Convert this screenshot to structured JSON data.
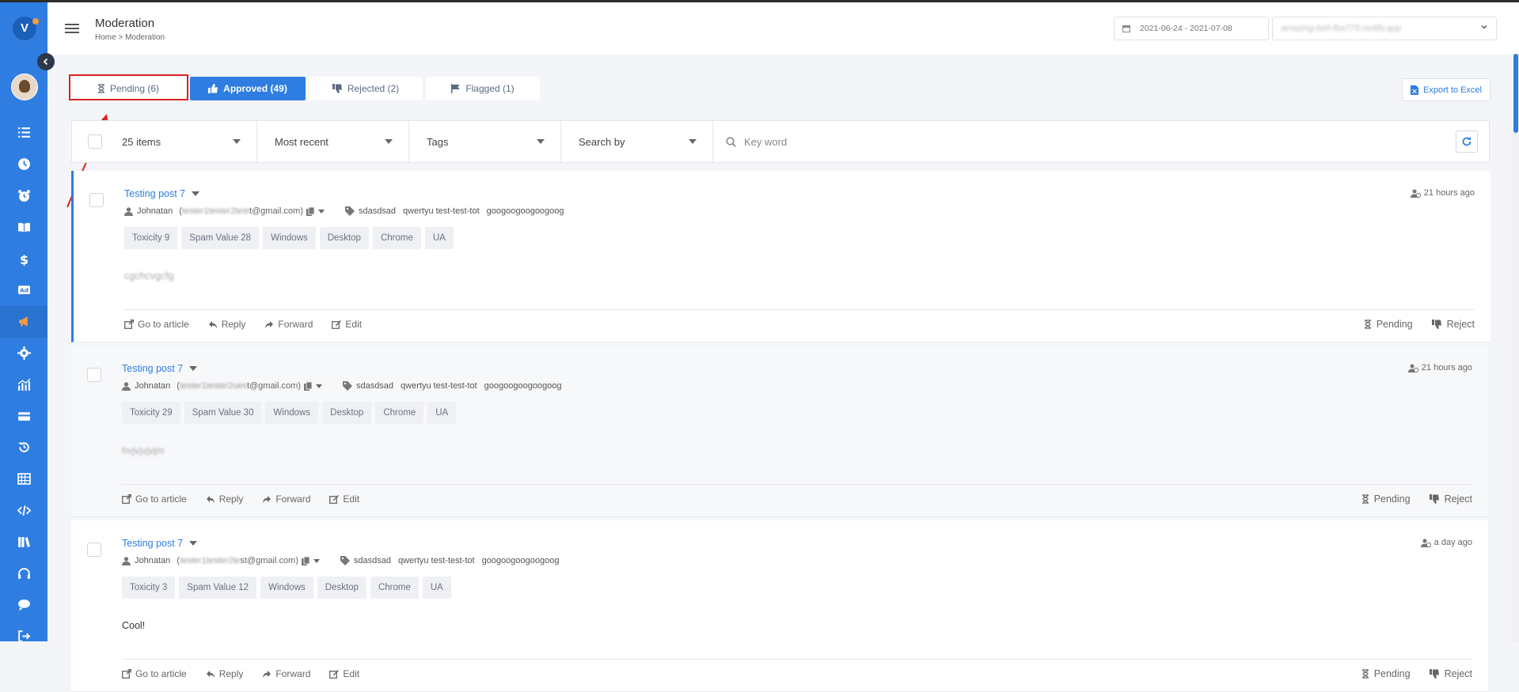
{
  "app": {
    "logo_letter": "V"
  },
  "header": {
    "title": "Moderation",
    "breadcrumb": "Home  > Moderation",
    "date_range": "2021-06-24 - 2021-07-08",
    "site": "amazing-bell-fba775.netlify.app"
  },
  "tabs": {
    "pending": "Pending (6)",
    "approved": "Approved (49)",
    "rejected": "Rejected (2)",
    "flagged": "Flagged (1)"
  },
  "export_label": "Export to Excel",
  "filters": {
    "items": "25 items",
    "sort": "Most recent",
    "tags": "Tags",
    "search_by": "Search by",
    "keyword_placeholder": "Key word"
  },
  "posts": [
    {
      "title": "Testing post 7",
      "time": "21 hours ago",
      "author": "Johnatan",
      "email_prefix": "(",
      "email_blur": "tester1tester2test",
      "email_suffix": "t@gmail.com)",
      "tags": [
        "sdasdsad",
        "qwertyu test-test-tot",
        "googoogoogoogoog"
      ],
      "chips": [
        "Toxicity 9",
        "Spam Value 28",
        "Windows",
        "Desktop",
        "Chrome",
        "UA"
      ],
      "content": "cgchcvgcfg"
    },
    {
      "title": "Testing post 7",
      "time": "21 hours ago",
      "author": "Johnatan",
      "email_prefix": "(",
      "email_blur": "tester1tester2ues",
      "email_suffix": "t@gmail.com)",
      "tags": [
        "sdasdsad",
        "qwertyu test-test-tot",
        "googoogoogoogoog"
      ],
      "chips": [
        "Toxicity 29",
        "Spam Value 30",
        "Windows",
        "Desktop",
        "Chrome",
        "UA"
      ],
      "content": "hvjvjvjvjm"
    },
    {
      "title": "Testing post 7",
      "time": "a day ago",
      "author": "Johnatan",
      "email_prefix": "(",
      "email_blur": "tester1tester2te",
      "email_suffix": "st@gmail.com)",
      "tags": [
        "sdasdsad",
        "qwertyu test-test-tot",
        "googoogoogoogoog"
      ],
      "chips": [
        "Toxicity 3",
        "Spam Value 12",
        "Windows",
        "Desktop",
        "Chrome",
        "UA"
      ],
      "content": "Cool!"
    }
  ],
  "actions": {
    "go_to_article": "Go to article",
    "reply": "Reply",
    "forward": "Forward",
    "edit": "Edit",
    "pending": "Pending",
    "reject": "Reject"
  },
  "sidebar_icons": [
    "list-icon",
    "clock-icon",
    "alarm-icon",
    "book-icon",
    "dollar-icon",
    "ad-icon",
    "megaphone-icon",
    "gear-icon",
    "chart-icon",
    "card-icon",
    "history-icon",
    "grid-icon",
    "code-icon",
    "library-icon",
    "headset-icon",
    "chat-icon",
    "logout-icon"
  ],
  "colors": {
    "accent": "#2f7de1",
    "highlight_box": "#e02020"
  }
}
